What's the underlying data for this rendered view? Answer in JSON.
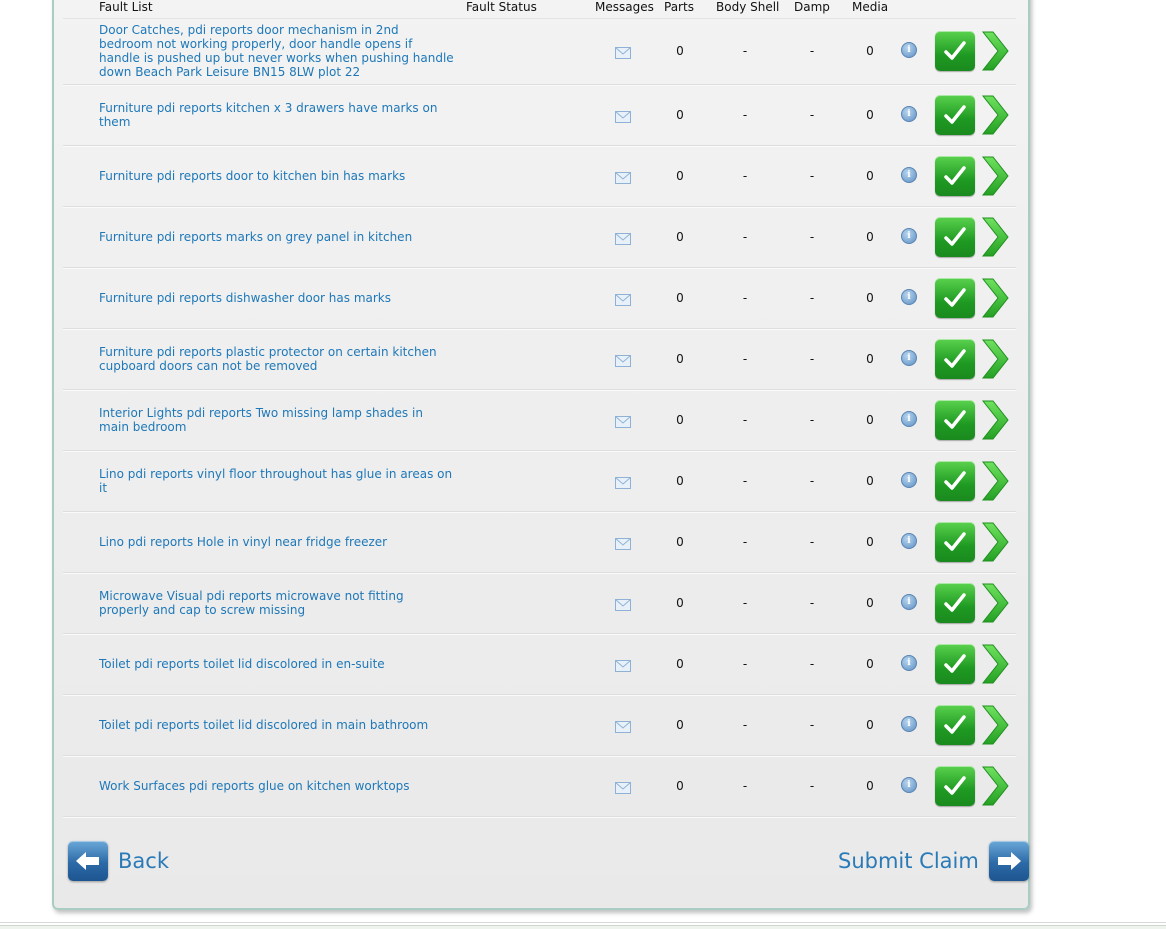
{
  "columns": {
    "fault_list": "Fault List",
    "fault_status": "Fault Status",
    "messages": "Messages",
    "parts": "Parts",
    "body_shell": "Body Shell",
    "damp": "Damp",
    "media": "Media"
  },
  "faults": [
    {
      "description": "Door Catches, pdi reports door mechanism in 2nd bedroom not working properly, door handle opens if handle is pushed up but never works when pushing handle down Beach Park Leisure BN15 8LW plot 22",
      "parts": "0",
      "body_shell": "-",
      "damp": "-",
      "media": "0"
    },
    {
      "description": "Furniture pdi reports kitchen x 3 drawers have marks on them",
      "parts": "0",
      "body_shell": "-",
      "damp": "-",
      "media": "0"
    },
    {
      "description": "Furniture pdi reports door to kitchen bin has marks",
      "parts": "0",
      "body_shell": "-",
      "damp": "-",
      "media": "0"
    },
    {
      "description": "Furniture pdi reports marks on grey panel in kitchen",
      "parts": "0",
      "body_shell": "-",
      "damp": "-",
      "media": "0"
    },
    {
      "description": "Furniture pdi reports dishwasher door has marks",
      "parts": "0",
      "body_shell": "-",
      "damp": "-",
      "media": "0"
    },
    {
      "description": "Furniture pdi reports plastic protector on certain kitchen cupboard doors can not be removed",
      "parts": "0",
      "body_shell": "-",
      "damp": "-",
      "media": "0"
    },
    {
      "description": "Interior Lights pdi reports Two missing lamp shades in main bedroom",
      "parts": "0",
      "body_shell": "-",
      "damp": "-",
      "media": "0"
    },
    {
      "description": "Lino pdi reports vinyl floor throughout has glue in areas on it",
      "parts": "0",
      "body_shell": "-",
      "damp": "-",
      "media": "0"
    },
    {
      "description": "Lino pdi reports Hole in vinyl near fridge freezer",
      "parts": "0",
      "body_shell": "-",
      "damp": "-",
      "media": "0"
    },
    {
      "description": "Microwave Visual pdi reports microwave not fitting properly and cap to screw missing",
      "parts": "0",
      "body_shell": "-",
      "damp": "-",
      "media": "0"
    },
    {
      "description": "Toilet pdi reports toilet lid discolored in en-suite",
      "parts": "0",
      "body_shell": "-",
      "damp": "-",
      "media": "0"
    },
    {
      "description": "Toilet pdi reports toilet lid discolored in main bathroom",
      "parts": "0",
      "body_shell": "-",
      "damp": "-",
      "media": "0"
    },
    {
      "description": "Work Surfaces pdi reports glue on kitchen worktops",
      "parts": "0",
      "body_shell": "-",
      "damp": "-",
      "media": "0"
    }
  ],
  "icons": {
    "message": "envelope-icon",
    "info": "info-icon",
    "approve": "checkmark-icon",
    "open": "chevron-right-icon"
  },
  "info_glyph": "i",
  "footer": {
    "back_label": "Back",
    "submit_label": "Submit Claim"
  },
  "colors": {
    "link": "#1e78b8",
    "approve_green": "#1f9a22",
    "arrow_green": "#3fc63a",
    "button_blue": "#2c6aa7"
  }
}
